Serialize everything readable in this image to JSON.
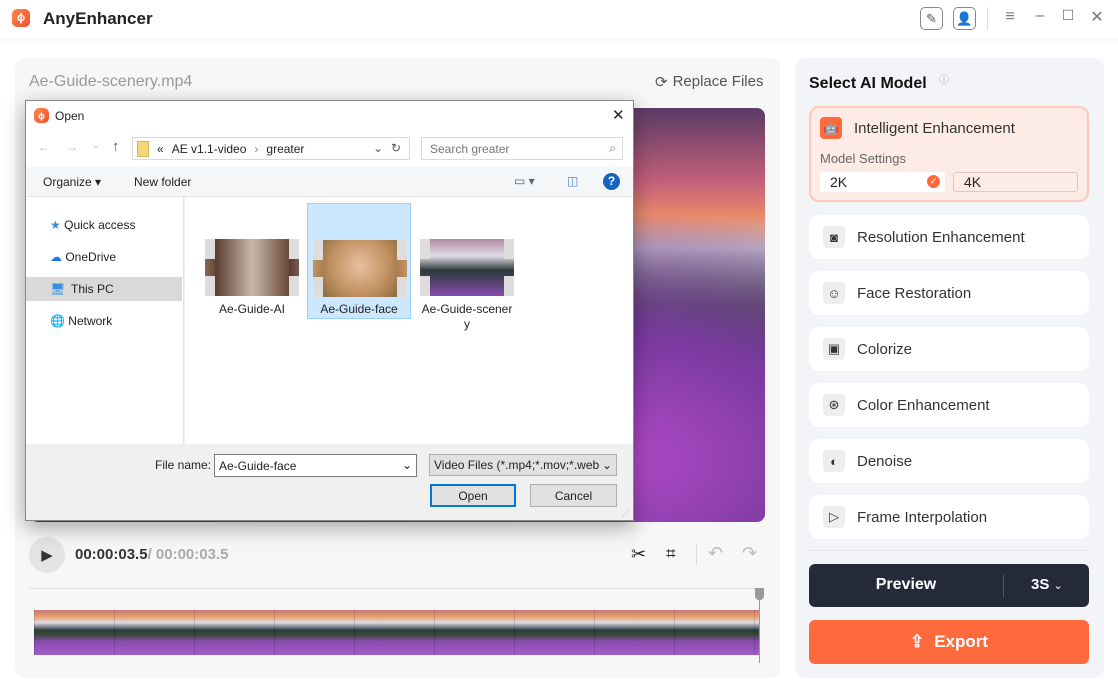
{
  "app": {
    "title": "AnyEnhancer"
  },
  "titlebar": {
    "icons": [
      "edit-icon",
      "user-icon",
      "menu-icon",
      "minimize-icon",
      "maximize-icon",
      "close-icon"
    ]
  },
  "editor": {
    "file_name": "Ae-Guide-scenery.mp4",
    "replace_label": "Replace Files",
    "current_time": "00:00:03.5",
    "separator": "/",
    "total_time": "00:00:03.5"
  },
  "sidebar": {
    "title": "Select AI Model",
    "selected": {
      "label": "Intelligent Enhancement",
      "settings_label": "Model Settings",
      "options": [
        "2K",
        "4K"
      ],
      "selected_option": "2K"
    },
    "models": [
      {
        "label": "Resolution Enhancement",
        "icon": "resolution-icon"
      },
      {
        "label": "Face Restoration",
        "icon": "face-icon"
      },
      {
        "label": "Colorize",
        "icon": "colorize-icon"
      },
      {
        "label": "Color Enhancement",
        "icon": "color-enhance-icon"
      },
      {
        "label": "Denoise",
        "icon": "denoise-icon"
      },
      {
        "label": "Frame Interpolation",
        "icon": "frame-interpolation-icon"
      }
    ],
    "preview_label": "Preview",
    "preview_duration": "3S",
    "export_label": "Export"
  },
  "dialog": {
    "title": "Open",
    "breadcrumb": [
      "«",
      "AE v1.1-video",
      "greater"
    ],
    "search_placeholder": "Search greater",
    "organize_label": "Organize",
    "new_folder_label": "New folder",
    "nav": [
      {
        "label": "Quick access"
      },
      {
        "label": "OneDrive"
      },
      {
        "label": "This PC"
      },
      {
        "label": "Network"
      }
    ],
    "files": [
      {
        "name": "Ae-Guide-AI"
      },
      {
        "name": "Ae-Guide-face"
      },
      {
        "name": "Ae-Guide-scener y"
      }
    ],
    "file_name_label": "File name:",
    "file_name_value": "Ae-Guide-face",
    "file_type": "Video Files (*.mp4;*.mov;*.web",
    "open_label": "Open",
    "cancel_label": "Cancel"
  },
  "colors": {
    "accent": "#ff6a3d",
    "dark": "#242a38",
    "selected_bg": "#fdebe6"
  }
}
